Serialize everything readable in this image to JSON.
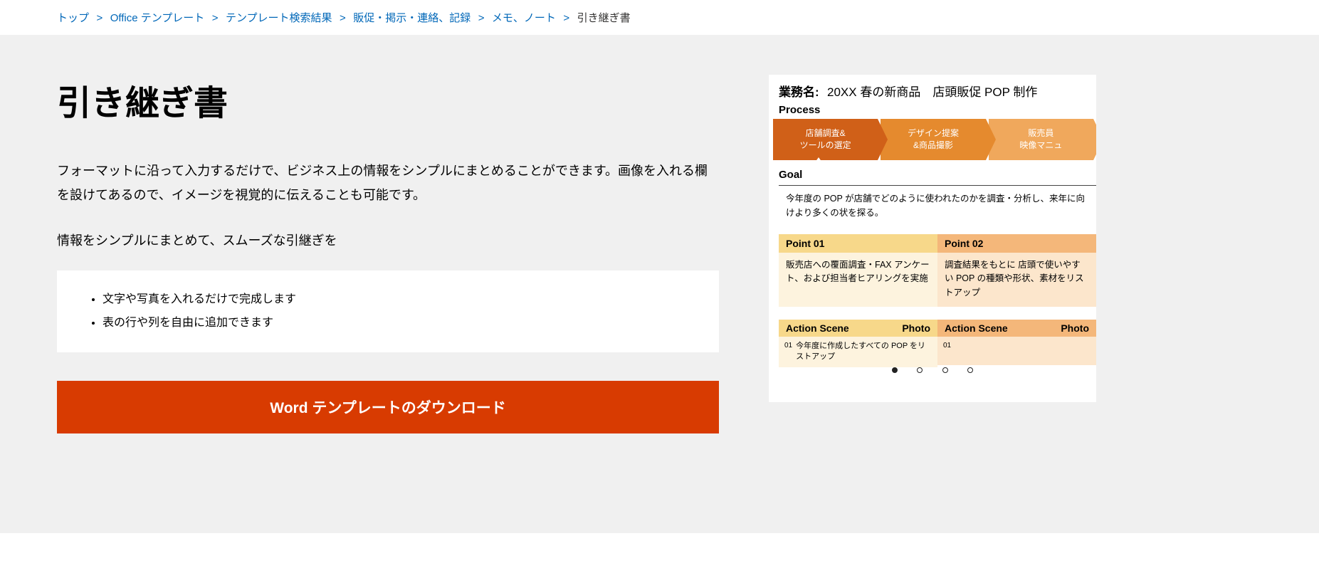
{
  "breadcrumb": {
    "items": [
      {
        "label": "トップ"
      },
      {
        "label": "Office テンプレート"
      },
      {
        "label": "テンプレート検索結果"
      },
      {
        "label": "販促・掲示・連絡、記録"
      },
      {
        "label": "メモ、ノート"
      }
    ],
    "current": "引き継ぎ書",
    "sep": ">"
  },
  "title": "引き継ぎ書",
  "desc1": "フォーマットに沿って入力するだけで、ビジネス上の情報をシンプルにまとめることができます。画像を入れる欄を設けてあるので、イメージを視覚的に伝えることも可能です。",
  "desc2": "情報をシンプルにまとめて、スムーズな引継ぎを",
  "features": [
    "文字や写真を入れるだけで完成します",
    "表の行や列を自由に追加できます"
  ],
  "download_label": "Word テンプレートのダウンロード",
  "preview": {
    "gyo_label": "業務名:",
    "gyo_value": "20XX 春の新商品　店頭販促 POP 制作",
    "process_label": "Process",
    "process": [
      {
        "l1": "店舗調査&",
        "l2": "ツールの選定"
      },
      {
        "l1": "デザイン提案",
        "l2": "&商品撮影"
      },
      {
        "l1": "販売員",
        "l2": "映像マニュ"
      }
    ],
    "goal_label": "Goal",
    "goal_text": "今年度の POP が店舗でどのように使われたのかを調査・分析し、来年に向けより多くの状を探る。",
    "points": [
      {
        "h": "Point 01",
        "b": "販売店への覆面調査・FAX アンケート、および担当者ヒアリングを実施"
      },
      {
        "h": "Point 02",
        "b": "調査結果をもとに\n店頭で使いやすい POP の種類や形状、素材をリストアップ"
      }
    ],
    "action": {
      "h_scene": "Action Scene",
      "h_photo": "Photo",
      "cols": [
        {
          "num": "01",
          "text": "今年度に作成したすべての\nPOP をリストアップ"
        },
        {
          "num": "01",
          "text": ""
        }
      ]
    }
  }
}
